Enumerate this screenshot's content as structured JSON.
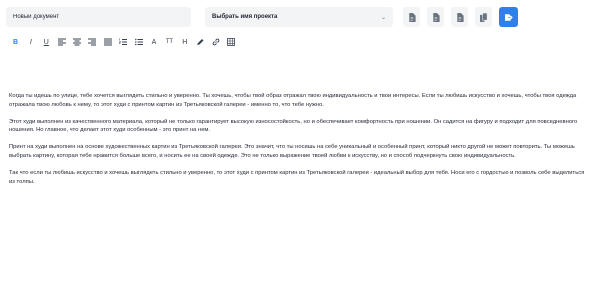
{
  "header": {
    "doc_name_value": "Новый документ",
    "project_select_label": "Выбрать имя проекта",
    "project_select_chevron": "chevron-down-icon",
    "action_icons": [
      "document-icon",
      "document-icon",
      "document-icon",
      "copy-icon",
      "send-document-icon"
    ]
  },
  "colors": {
    "accent": "#2f80ed",
    "field_bg": "#f3f4f6",
    "text": "#1f2430"
  },
  "toolbar": {
    "bold": "B",
    "italic": "I",
    "underline": "U",
    "font_size": "A",
    "text_height": "TT",
    "heading": "H",
    "tools": [
      "bold-icon",
      "italic-icon",
      "underline-icon",
      "align-left-icon",
      "align-center-icon",
      "align-right-icon",
      "align-justify-icon",
      "ordered-list-icon",
      "bullet-list-icon",
      "font-size-icon",
      "text-height-icon",
      "heading-icon",
      "highlight-icon",
      "link-icon",
      "table-icon"
    ]
  },
  "content": {
    "paragraphs": [
      "Когда ты идешь по улице, тебе хочется выглядеть стильно и уверенно. Ты хочешь, чтобы твой образ отражал твою индивидуальность и твои интересы. Если ты любишь искусство и хочешь, чтобы твоя одежда отражала твою любовь к нему, то этот худи с принтом картин из Третьяковской галереи - именно то, что тебе нужно.",
      "Этот худи выполнен из качественного материала, который не только гарантирует высокую износостойкость, но и обеспечивает комфортность при ношении. Он садится на фигуру и подходит для повседневного ношения. Но главное, что делает этот худи особенным - это принт на нем.",
      "Принт на худи выполнен на основе художественных картин из Третьяковской галереи. Это значит, что ты носишь на себе уникальный и особенный принт, который никто другой не может повторить. Ты можешь выбрать картину, которая тебе нравится больше всего, и носить ее на своей одежде. Это не только выражение твоей любви к искусству, но и способ подчеркнуть свою индивидуальность.",
      "Так что если ты любишь искусство и хочешь выглядеть стильно и уверенно, то этот худи с принтом картин из Третьяковской галереи - идеальный выбор для тебя. Носи его с гордостью и позволь себе выделиться из толпы."
    ]
  }
}
